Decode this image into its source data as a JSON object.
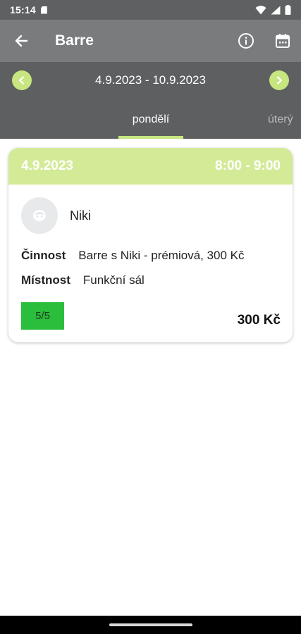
{
  "status": {
    "time": "15:14"
  },
  "header": {
    "title": "Barre"
  },
  "week": {
    "range": "4.9.2023 - 10.9.2023"
  },
  "tabs": [
    {
      "label": "pondělí",
      "active": true
    },
    {
      "label": "úterý",
      "active": false
    }
  ],
  "session": {
    "date": "4.9.2023",
    "time": "8:00 - 9:00",
    "trainer": "Niki",
    "activity_label": "Činnost",
    "activity_value": "Barre s Niki - prémiová, 300 Kč",
    "room_label": "Místnost",
    "room_value": "Funkční sál",
    "capacity": "5/5",
    "price": "300 Kč"
  },
  "colors": {
    "accent": "#c7e67f",
    "card_header": "#d3eb97",
    "capacity_full": "#2bbd3c",
    "app_bar": "#7a7b7d",
    "week_bar": "#5e5f61"
  },
  "icons": {
    "back": "arrow-left-icon",
    "info": "info-icon",
    "calendar": "calendar-icon",
    "prev": "chevron-left-icon",
    "next": "chevron-right-icon",
    "avatar": "avatar-placeholder-icon"
  }
}
